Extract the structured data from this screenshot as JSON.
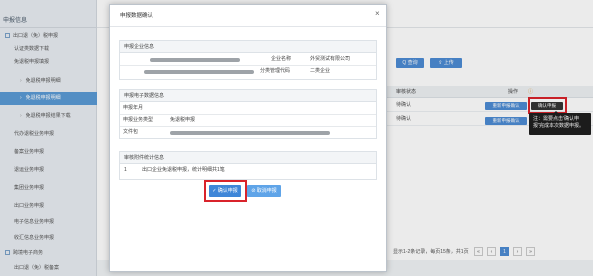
{
  "sidebar": {
    "title": "申报信息",
    "items": [
      {
        "label": "出口退（免）税申报",
        "level": 1,
        "expanded": true
      },
      {
        "label": "认证类数据下载",
        "level": 2
      },
      {
        "label": "免退税申报填报",
        "level": 2,
        "expanded": true
      },
      {
        "label": "免退税申报明细",
        "level": 3
      },
      {
        "label": "免退税申报明细",
        "level": 3,
        "active": true
      },
      {
        "label": "免退税申报结果下载",
        "level": 3
      },
      {
        "label": "代办退税业务申报",
        "level": 2
      },
      {
        "label": "备案业务申报",
        "level": 2
      },
      {
        "label": "退运业务申报",
        "level": 2
      },
      {
        "label": "集团业务申报",
        "level": 2
      },
      {
        "label": "出口业务申报",
        "level": 2
      },
      {
        "label": "电子信息业务申报",
        "level": 2
      },
      {
        "label": "收汇信息业务申报",
        "level": 2
      },
      {
        "label": "跨境电子商务",
        "level": 1
      },
      {
        "label": "出口退（免）税备案",
        "level": 2
      }
    ]
  },
  "toolbar": {
    "query_label": "Q 查询",
    "upload_label": "⇪ 上传"
  },
  "grid": {
    "headers": {
      "status": "审核状态",
      "op": "操作"
    },
    "rows": [
      {
        "status": "待确认",
        "btn1": "重新申报确认",
        "btn2": "确认申报"
      },
      {
        "status": "待确认",
        "btn1": "重新申报确认",
        "btn2": ""
      }
    ]
  },
  "tooltip": "注：需要点击'确认申报'完成本次数据申报。",
  "pager": {
    "text": "显示1-2条记录，每页15条，共1页"
  },
  "modal": {
    "title": "申报数据确认",
    "enterprise": {
      "section": "申报企业信息",
      "name_label": "企业名称",
      "name_value": "外贸测试有限公司",
      "class_label": "分类管理代码",
      "class_value": "二类企业"
    },
    "electronic": {
      "section": "申报电子数据信息",
      "ym_label": "申报年月",
      "type_label": "申报业务类型",
      "type_value": "免退税申报",
      "file_label": "文件包"
    },
    "summary": {
      "section": "审核附件统计信息",
      "index": "1",
      "text": "出口企业免退税申报，统计明细共1笔"
    },
    "confirm_label": "确认申报",
    "cancel_label": "取消申报"
  },
  "colors": {
    "accent": "#4c8bd4",
    "highlight": "#d9232b",
    "sidebar_active": "#5b9bd5"
  }
}
